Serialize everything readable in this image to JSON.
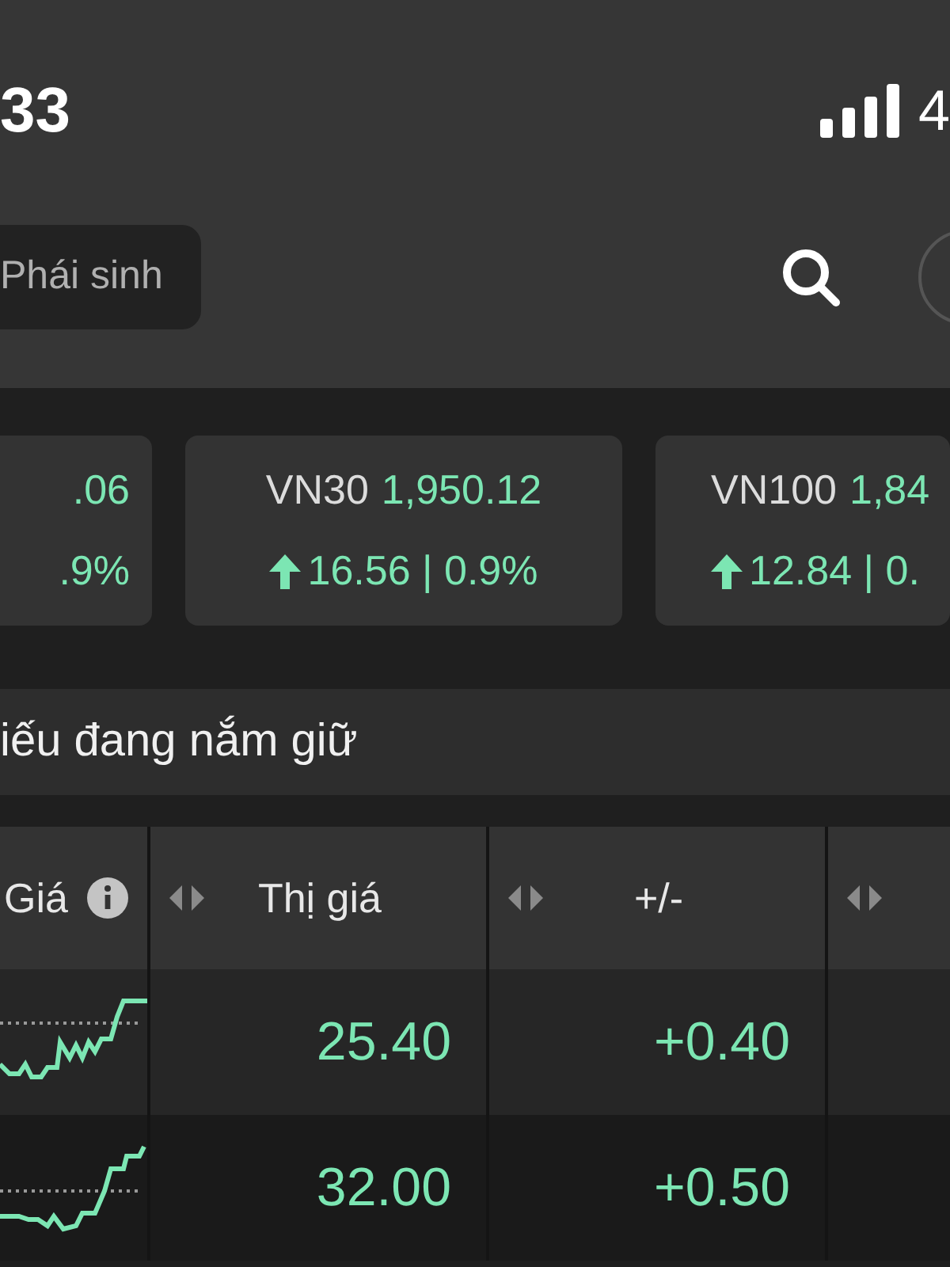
{
  "status_bar": {
    "time": "33",
    "battery": "4"
  },
  "tabs": [
    {
      "label": "Phái sinh",
      "selected": false
    }
  ],
  "index_cards": [
    {
      "value": ".06",
      "change": ".9%"
    },
    {
      "name": "VN30",
      "value": "1,950.12",
      "up_arrow": true,
      "change": "16.56 | 0.9%"
    },
    {
      "name": "VN100",
      "value": "1,84",
      "up_arrow": true,
      "change": "12.84 | 0."
    }
  ],
  "section_title": "iếu đang nắm giữ",
  "table": {
    "columns": [
      {
        "label": "Giá",
        "info": true
      },
      {
        "label": "Thị giá"
      },
      {
        "label": "+/-"
      },
      {}
    ],
    "rows": [
      {
        "price": "25.40",
        "change": "+0.40"
      },
      {
        "price": "32.00",
        "change": "+0.50"
      }
    ]
  }
}
